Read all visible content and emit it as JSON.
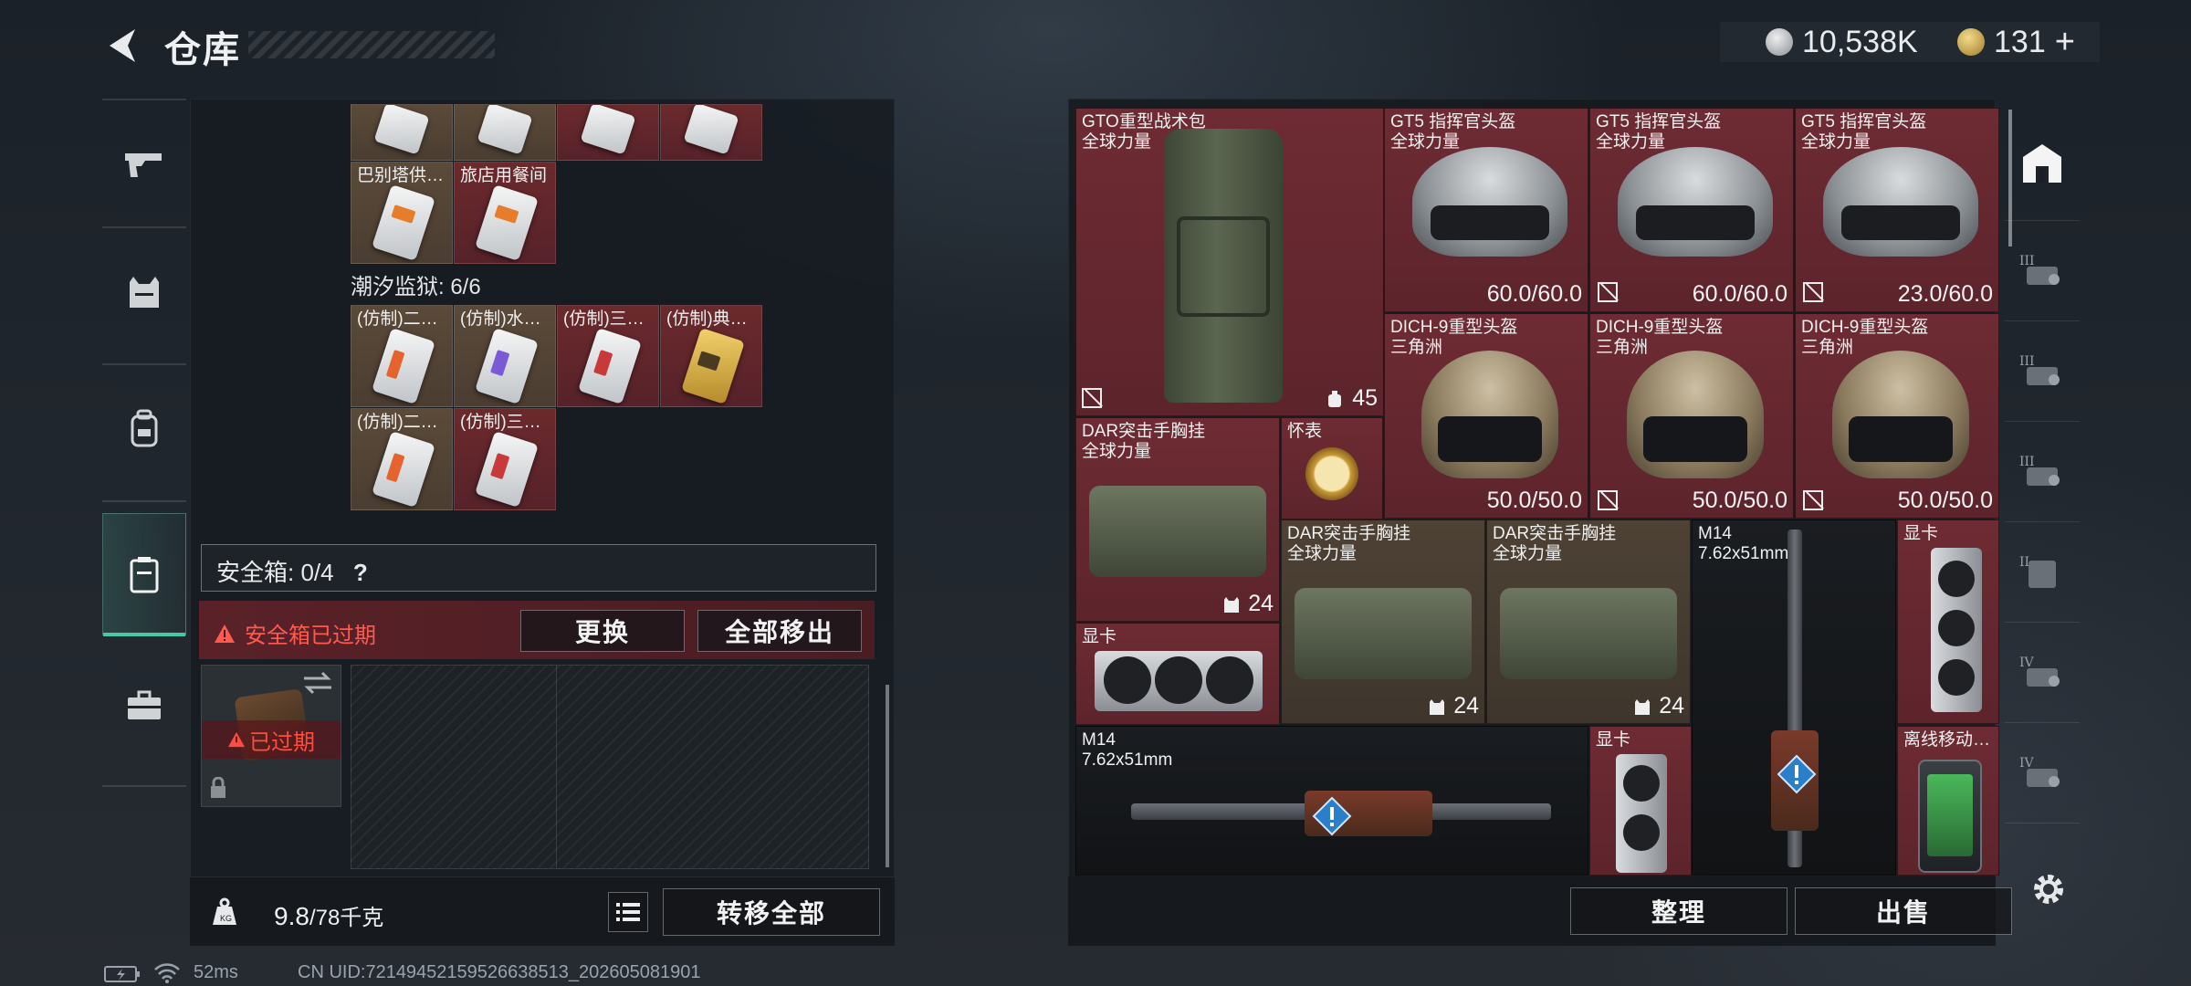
{
  "header": {
    "title": "仓库",
    "currency1": "10,538K",
    "currency2": "131",
    "currency2_plus": "+"
  },
  "left_rail": [
    "gun-icon",
    "vest-icon",
    "backpack-icon",
    "safe-box-icon",
    "briefcase-icon"
  ],
  "left_panel": {
    "top_row_labels": [
      "",
      "",
      "",
      ""
    ],
    "row2": [
      {
        "label": "巴别塔供…"
      },
      {
        "label": "旅店用餐间"
      }
    ],
    "section_title": "潮汐监狱: 6/6",
    "prison_row1": [
      {
        "label": "(仿制)二…"
      },
      {
        "label": "(仿制)水…"
      },
      {
        "label": "(仿制)三…"
      },
      {
        "label": "(仿制)典…"
      }
    ],
    "prison_row2": [
      {
        "label": "(仿制)二…"
      },
      {
        "label": "(仿制)三…"
      }
    ],
    "safebox_label": "安全箱: 0/4",
    "safebox_help": "?",
    "expired_warning": "安全箱已过期",
    "replace_button": "更换",
    "move_all_out_button": "全部移出",
    "case_expired": "已过期",
    "weight": "9.8",
    "weight_max": "/78千克",
    "transfer_all_button": "转移全部"
  },
  "right_panel": {
    "items": {
      "backpack": {
        "name": "GTO重型战术包",
        "sub": "全球力量",
        "count": "45"
      },
      "helmet1": {
        "name": "GT5 指挥官头盔",
        "sub": "全球力量",
        "dur": "60.0/60.0"
      },
      "helmet2": {
        "name": "GT5 指挥官头盔",
        "sub": "全球力量",
        "dur": "60.0/60.0"
      },
      "helmet3": {
        "name": "GT5 指挥官头盔",
        "sub": "全球力量",
        "dur": "23.0/60.0"
      },
      "dich1": {
        "name": "DICH-9重型头盔",
        "sub": "三角洲",
        "dur": "50.0/50.0"
      },
      "dich2": {
        "name": "DICH-9重型头盔",
        "sub": "三角洲",
        "dur": "50.0/50.0"
      },
      "dich3": {
        "name": "DICH-9重型头盔",
        "sub": "三角洲",
        "dur": "50.0/50.0"
      },
      "rig1": {
        "name": "DAR突击手胸挂",
        "sub": "全球力量",
        "count": "24"
      },
      "watch": {
        "name": "怀表"
      },
      "rig2": {
        "name": "DAR突击手胸挂",
        "sub": "全球力量",
        "count": "24"
      },
      "rig3": {
        "name": "DAR突击手胸挂",
        "sub": "全球力量",
        "count": "24"
      },
      "m14_vertical": {
        "name": "M14",
        "sub": "7.62x51mm"
      },
      "gpu1": {
        "name": "显卡"
      },
      "gpu2": {
        "name": "显卡"
      },
      "gpu3": {
        "name": "显卡"
      },
      "m14_horizontal": {
        "name": "M14",
        "sub": "7.62x51mm"
      },
      "offline": {
        "name": "离线移动…"
      }
    },
    "tidy_button": "整理",
    "sell_button": "出售"
  },
  "right_rail": [
    "home-icon",
    "tier-iii-icon",
    "tier-iii-icon",
    "tier-iii-icon",
    "tier-ii-icon",
    "tier-iv-icon",
    "tier-iv-icon"
  ],
  "status": {
    "ping": "52ms",
    "uid": "CN UID:72149452159526638513_202605081901"
  },
  "colors": {
    "accent": "#46c9a6",
    "warning": "#ff5a4e",
    "item_red": "#6e2b33"
  }
}
